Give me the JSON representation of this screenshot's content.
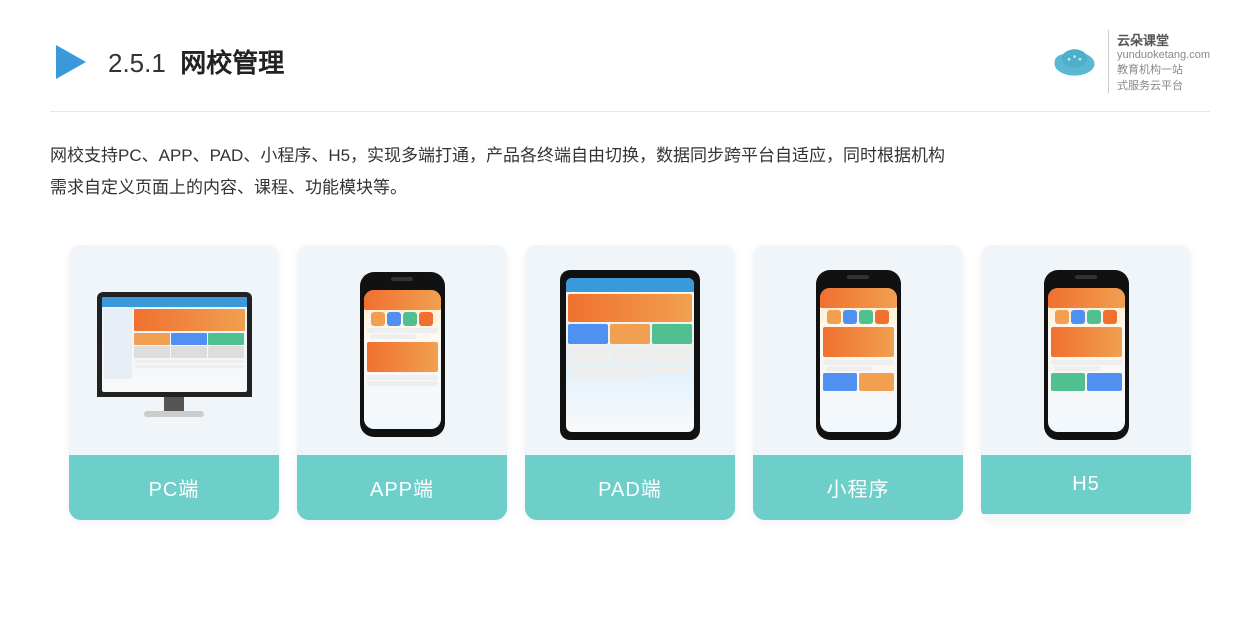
{
  "header": {
    "section_num": "2.5.1",
    "title": "网校管理",
    "brand_name": "云朵课堂",
    "brand_url": "yunduoketang.com",
    "brand_tagline1": "教育机构一站",
    "brand_tagline2": "式服务云平台"
  },
  "description": {
    "line1": "网校支持PC、APP、PAD、小程序、H5，实现多端打通，产品各终端自由切换，数据同步跨平台自适应，同时根据机构",
    "line2": "需求自定义页面上的内容、课程、功能模块等。"
  },
  "cards": [
    {
      "id": "pc",
      "label": "PC端"
    },
    {
      "id": "app",
      "label": "APP端"
    },
    {
      "id": "pad",
      "label": "PAD端"
    },
    {
      "id": "miniprogram",
      "label": "小程序"
    },
    {
      "id": "h5",
      "label": "H5"
    }
  ]
}
